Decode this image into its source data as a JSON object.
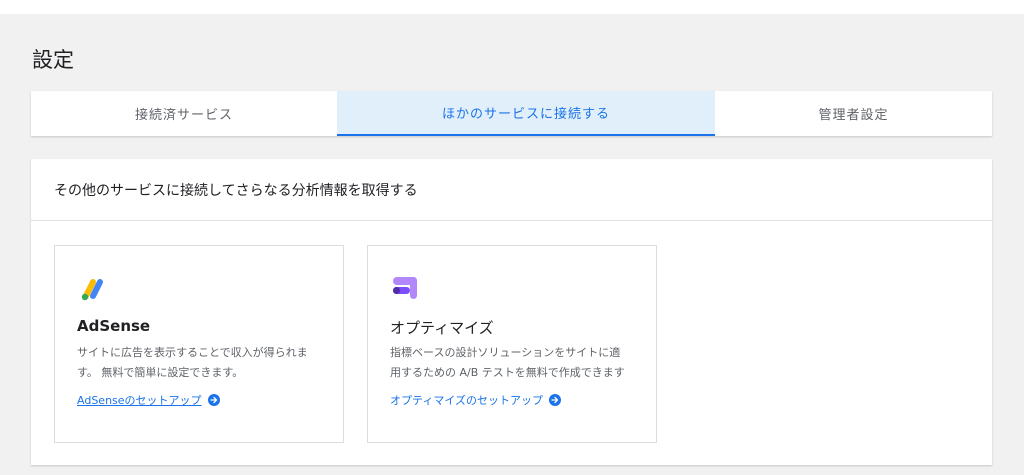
{
  "page": {
    "title": "設定"
  },
  "tabs": [
    {
      "label": "接続済サービス"
    },
    {
      "label": "ほかのサービスに接続する"
    },
    {
      "label": "管理者設定"
    }
  ],
  "panel": {
    "header": "その他のサービスに接続してさらなる分析情報を取得する"
  },
  "cards": [
    {
      "icon": "adsense-logo",
      "title": "AdSense",
      "desc_line1": "サイトに広告を表示することで収入が得られま",
      "desc_line2": "す。 無料で簡単に設定できます。",
      "link": "AdSenseのセットアップ"
    },
    {
      "icon": "optimize-logo",
      "title": "オプティマイズ",
      "desc_line1": "指標ベースの設計ソリューションをサイトに適",
      "desc_line2": "用するための A/B テストを無料で作成できます",
      "link": "オプティマイズのセットアップ"
    }
  ],
  "colors": {
    "accent": "#1a73e8",
    "active_tab_bg": "#e1effb",
    "page_bg": "#f1f1f1"
  }
}
